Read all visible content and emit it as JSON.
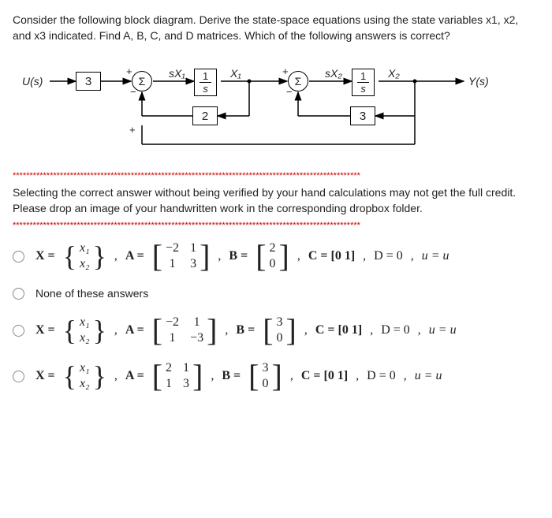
{
  "question": "Consider the following block diagram. Derive the state-space equations using the state variables x1, x2, and x3 indicated. Find A, B, C, and D matrices. Which of the following answers is correct?",
  "diagram": {
    "input_label": "U(s)",
    "output_label": "Y(s)",
    "gain_input": "3",
    "sum1": "Σ",
    "sum2": "Σ",
    "integ1_num": "1",
    "integ1_den": "s",
    "integ2_num": "1",
    "integ2_den": "s",
    "fb1": "2",
    "fb2": "3",
    "sX1": "sX₁",
    "sX2": "sX₂",
    "X1": "X₁",
    "X2": "X₂",
    "plus": "+",
    "minus": "−"
  },
  "note": "Selecting the correct answer without being verified by your hand calculations may not get the full credit. Please drop an image of your handwritten work in the corresponding dropbox folder.",
  "separator": "*******************************************************************************************************",
  "options": {
    "none": "None of these answers",
    "opt1": {
      "xv": [
        "x₁",
        "x₂"
      ],
      "A": [
        [
          "−2",
          "1"
        ],
        [
          "1",
          "3"
        ]
      ],
      "B": [
        "2",
        "0"
      ],
      "C": "C = [0   1]",
      "D": "D = 0",
      "u": "u = u"
    },
    "opt3": {
      "xv": [
        "x₁",
        "x₂"
      ],
      "A": [
        [
          "−2",
          "1"
        ],
        [
          "1",
          "−3"
        ]
      ],
      "B": [
        "3",
        "0"
      ],
      "C": "C = [0   1]",
      "D": "D = 0",
      "u": "u = u"
    },
    "opt4": {
      "xv": [
        "x₁",
        "x₂"
      ],
      "A": [
        [
          "2",
          "1"
        ],
        [
          "1",
          "3"
        ]
      ],
      "B": [
        "3",
        "0"
      ],
      "C": "C = [0   1]",
      "D": "D = 0",
      "u": "u = u"
    }
  },
  "labels": {
    "X_eq": "X =",
    "A_eq": "A =",
    "B_eq": "B =",
    "comma": ","
  }
}
